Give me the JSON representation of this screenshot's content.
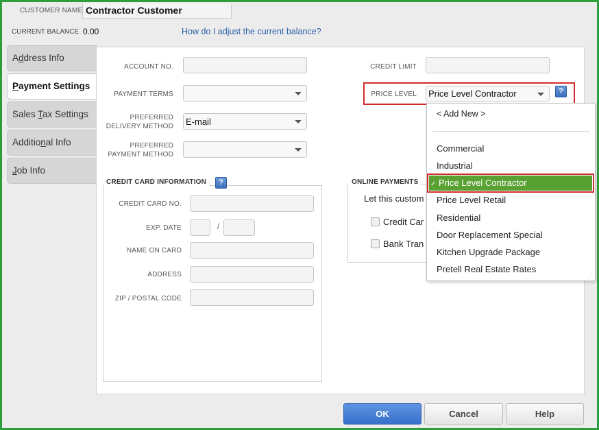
{
  "header": {
    "customer_name_label": "CUSTOMER NAME",
    "customer_name": "Contractor Customer",
    "current_balance_label": "CURRENT BALANCE",
    "current_balance": "0.00",
    "adjust_link": "How do I adjust the current balance?"
  },
  "tabs": [
    {
      "label_pre": "A",
      "label_u": "d",
      "label_post": "dress Info"
    },
    {
      "label_pre": "",
      "label_u": "P",
      "label_post": "ayment Settings"
    },
    {
      "label_pre": "Sales ",
      "label_u": "T",
      "label_post": "ax Settings"
    },
    {
      "label_pre": "Additio",
      "label_u": "n",
      "label_post": "al Info"
    },
    {
      "label_pre": "",
      "label_u": "J",
      "label_post": "ob Info"
    }
  ],
  "payment": {
    "account_no_label": "ACCOUNT NO.",
    "account_no": "",
    "payment_terms_label": "PAYMENT TERMS",
    "payment_terms": "",
    "delivery_label_1": "PREFERRED",
    "delivery_label_2": "DELIVERY METHOD",
    "delivery_method": "E-mail",
    "pay_method_label_1": "PREFERRED",
    "pay_method_label_2": "PAYMENT METHOD",
    "pay_method": "",
    "credit_limit_label": "CREDIT LIMIT",
    "credit_limit": "",
    "price_level_label": "PRICE LEVEL",
    "price_level": "Price Level Contractor"
  },
  "credit_card": {
    "title": "CREDIT CARD INFORMATION",
    "card_no_label": "CREDIT CARD NO.",
    "exp_label": "EXP. DATE",
    "exp_sep": "/",
    "name_label": "NAME ON CARD",
    "address_label": "ADDRESS",
    "zip_label": "ZIP / POSTAL CODE"
  },
  "online": {
    "title": "ONLINE PAYMENTS",
    "text": "Let this custom",
    "opt1": "Credit Car",
    "opt2": "Bank Tran"
  },
  "dropdown": {
    "add_new": "< Add New >",
    "items": [
      "Commercial",
      "Industrial",
      "Price Level Contractor",
      "Price Level Retail",
      "Residential",
      "Door Replacement Special",
      "Kitchen Upgrade Package",
      "Pretell Real Estate Rates"
    ],
    "check": "✓"
  },
  "buttons": {
    "ok": "OK",
    "cancel": "Cancel",
    "help": "Help"
  },
  "help_glyph": "?",
  "icons": {
    "help": "help-icon",
    "caret": "chevron-down-icon",
    "resize": "resize-grip-icon"
  }
}
